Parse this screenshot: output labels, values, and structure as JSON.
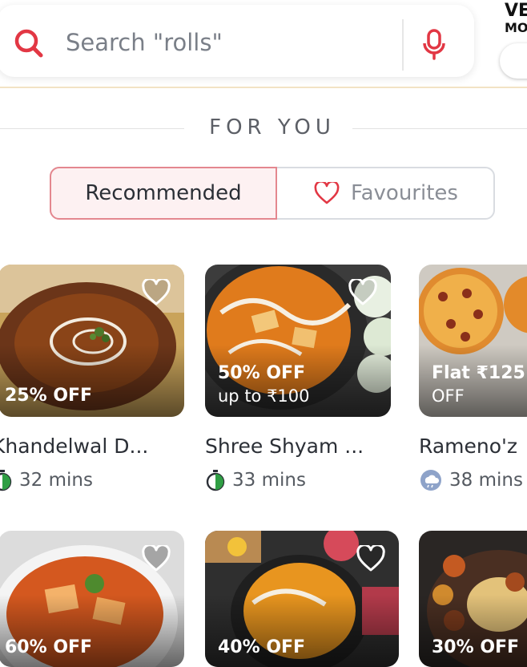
{
  "search": {
    "placeholder": "Search \"rolls\""
  },
  "veg_toggle": {
    "line1": "VE",
    "line2": "MO"
  },
  "section": {
    "title": "FOR YOU"
  },
  "tabs": {
    "recommended": "Recommended",
    "favourites": "Favourites"
  },
  "colors": {
    "accent": "#e23744",
    "active_tab_bg": "#fdf1f2",
    "active_tab_border": "#e4878f"
  },
  "restaurants": [
    {
      "name": "Khandelwal D...",
      "offer": "25% OFF",
      "offer_sub": "",
      "time": "32 mins",
      "time_icon": "stopwatch-icon"
    },
    {
      "name": "Shree Shyam ...",
      "offer": "50% OFF",
      "offer_sub": "up to ₹100",
      "time": "33 mins",
      "time_icon": "stopwatch-icon"
    },
    {
      "name": "Rameno'z",
      "offer": "Flat ₹125",
      "offer_sub": "OFF",
      "time": "38 mins",
      "time_icon": "rain-cloud-icon"
    },
    {
      "name": "",
      "offer": "60% OFF",
      "offer_sub": "",
      "time": "",
      "time_icon": ""
    },
    {
      "name": "",
      "offer": "40% OFF",
      "offer_sub": "",
      "time": "",
      "time_icon": ""
    },
    {
      "name": "",
      "offer": "30% OFF",
      "offer_sub": "",
      "time": "",
      "time_icon": ""
    }
  ]
}
